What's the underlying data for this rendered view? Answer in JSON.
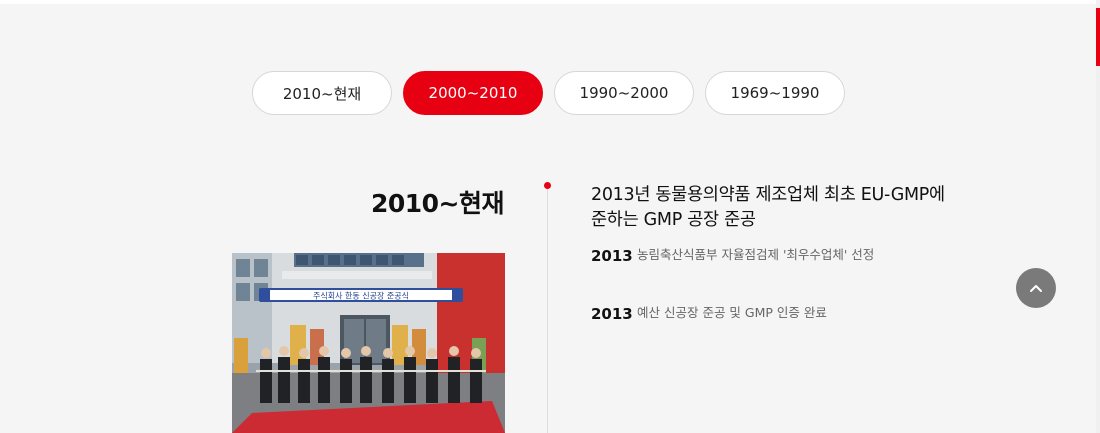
{
  "tabs": [
    {
      "label": "2010~현재",
      "active": false
    },
    {
      "label": "2000~2010",
      "active": true
    },
    {
      "label": "1990~2000",
      "active": false
    },
    {
      "label": "1969~1990",
      "active": false
    }
  ],
  "section": {
    "period_title": "2010~현재",
    "photo_banner": "주식회사 한동 신공장 준공식"
  },
  "timeline": {
    "headline_line1": "2013년 동물용의약품 제조업체 최초 EU-GMP에",
    "headline_line2": "준하는 GMP 공장 준공",
    "events": [
      {
        "year": "2013",
        "desc": "농림축산식품부 자율점검제 '최우수업체' 선정"
      },
      {
        "year": "2013",
        "desc": "예산 신공장 준공 및 GMP 인증 완료"
      }
    ]
  },
  "colors": {
    "accent": "#e60012",
    "background": "#f5f5f5",
    "scroll_top_button": "#7a7a7a"
  },
  "icons": {
    "scroll_top": "chevron-up-icon"
  }
}
